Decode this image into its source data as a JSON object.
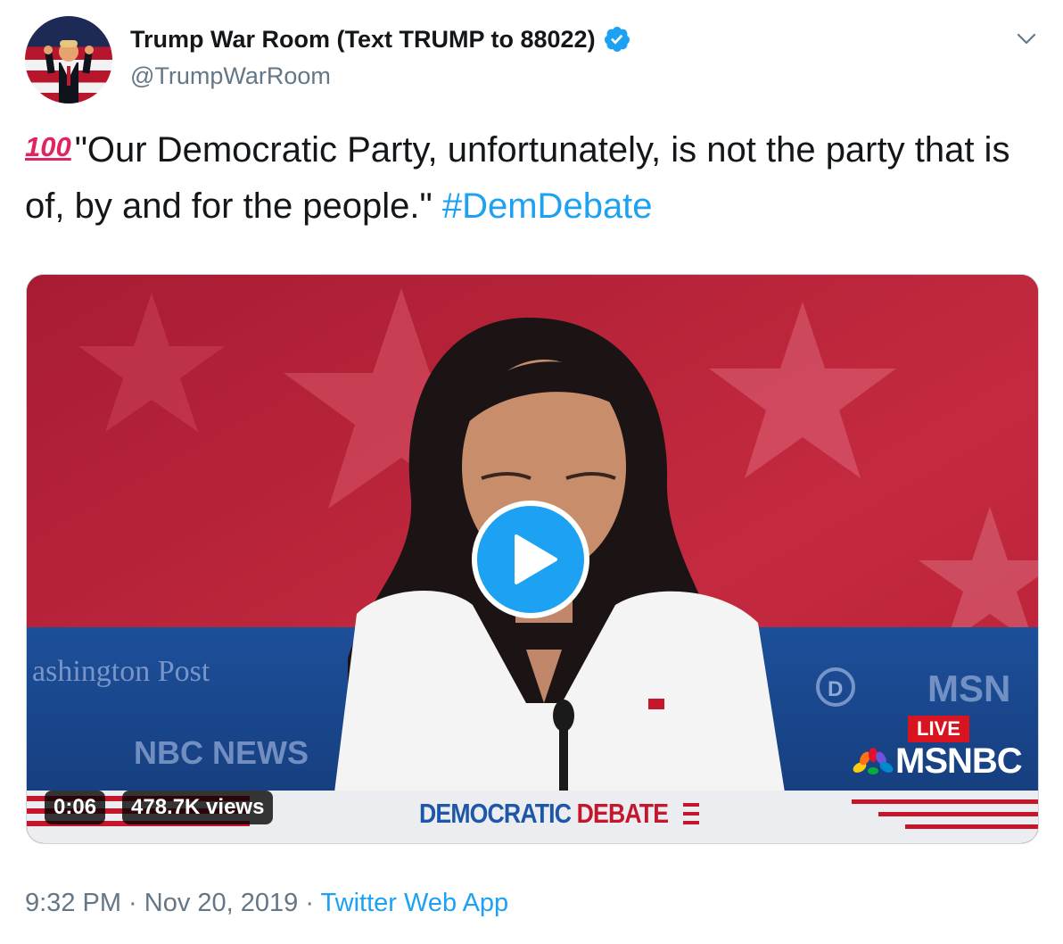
{
  "author": {
    "display_name": "Trump War Room (Text TRUMP to 88022)",
    "handle": "@TrumpWarRoom",
    "verified_icon": "verified-badge-icon"
  },
  "tweet": {
    "emoji": "100",
    "text": "\"Our Democratic Party, unfortunately, is not the party that is of, by and for the people.\" ",
    "hashtag": "#DemDebate"
  },
  "video": {
    "duration": "0:06",
    "views": "478.7K views",
    "overlay": {
      "live": "LIVE",
      "network": "MSNBC",
      "debate_word1": "DEMOCRATIC",
      "debate_word2": "DEBATE"
    }
  },
  "meta": {
    "time": "9:32 PM",
    "separator": " · ",
    "date": "Nov 20, 2019",
    "source": "Twitter Web App"
  },
  "colors": {
    "link": "#1da1f2",
    "text": "#14171a",
    "secondary": "#657786"
  }
}
